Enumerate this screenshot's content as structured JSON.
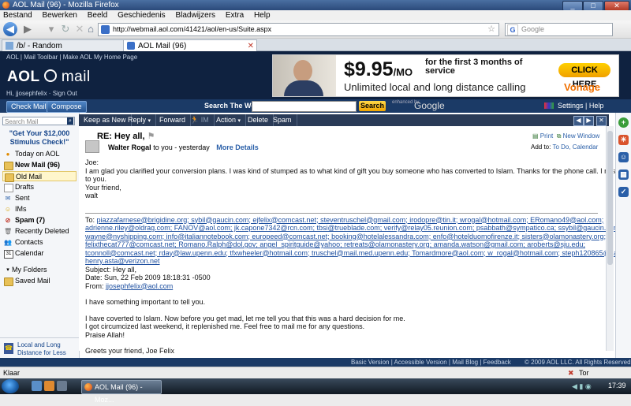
{
  "window": {
    "title": "AOL Mail (96) - Mozilla Firefox",
    "buttons": [
      "_",
      "□",
      "✕"
    ]
  },
  "menu": [
    "Bestand",
    "Bewerken",
    "Beeld",
    "Geschiedenis",
    "Bladwijzers",
    "Extra",
    "Help"
  ],
  "nav": {
    "url": "http://webmail.aol.com/41421/aol/en-us/Suite.aspx",
    "search_placeholder": "Google"
  },
  "tabs": [
    {
      "label": "/b/ - Random"
    },
    {
      "label": "AOL Mail (96)"
    }
  ],
  "aol": {
    "toplinks": "AOL  |  Mail Toolbar  |  Make AOL My Home Page",
    "logo_aol": "AOL",
    "logo_mail": "mail",
    "hi": "Hi, jjosephfelix  ·  Sign Out",
    "check_mail": "Check Mail",
    "compose": "Compose",
    "search_web_label": "Search The Web",
    "search_button": "Search",
    "enhanced_by": "enhanced by",
    "google": "Google",
    "settings": "Settings  |  Help"
  },
  "ad": {
    "price": "$9.95",
    "per": "/MO",
    "first3": "for the first 3 months of service",
    "unlimited": "Unlimited local and long distance calling",
    "cta": "CLICK HERE",
    "brand": "Vonage"
  },
  "toolbar": {
    "keep_as_new": "Keep as New",
    "reply": "Reply",
    "forward": "Forward",
    "im": "IM",
    "action": "Action",
    "delete": "Delete",
    "spam": "Spam"
  },
  "sidebar": {
    "search_placeholder": "Search Mail",
    "promo": "\"Get Your $12,000 Stimulus Check!\"",
    "items": [
      {
        "label": "Today on AOL"
      },
      {
        "label": "New Mail (96)"
      },
      {
        "label": "Old Mail"
      },
      {
        "label": "Drafts"
      },
      {
        "label": "Sent"
      },
      {
        "label": "IMs"
      },
      {
        "label": "Spam (7)"
      },
      {
        "label": "Recently Deleted"
      },
      {
        "label": "Contacts"
      },
      {
        "label": "Calendar"
      }
    ],
    "my_folders": "My Folders",
    "saved_mail": "Saved Mail",
    "local_ad": "Local and Long Distance for Less"
  },
  "message": {
    "subject": "RE: Hey all,",
    "from_name": "Walter Rogal",
    "from_meta": "to you - yesterday",
    "more_details": "More Details",
    "print": "Print",
    "new_window": "New Window",
    "add_to_label": "Add to:",
    "add_to_links": "To Do, Calendar",
    "body_top": [
      "Joe:",
      "I am glad you clarified your conversion plans.  I was kind of stumped as to what kind of gift you buy someone who has converted to Islam.  Thanks for the phone call.  I miss talking",
      "to you.",
      "Your friend,",
      "walt"
    ],
    "to_label": "To:",
    "to_lines": [
      "piazzafarnese@brigidine.org; sybil@gaucin.com; ejfelix@comcast.net; steventruschel@gmail.com; irodopre@tin.it; wrogal@hotmail.com; ERomano49@aol.com;",
      "adrienne.riley@oldrag.com; FANOV@aol.com; jk.capone7342@rcn.com; tbsi@trueblade.com; verify@relay05.reunion.com; psabbath@sympatico.ca; ssybil@gaucin.comy;",
      "wayne@nyshipping.com; info@italiannotebook.com; europeed@comcast.net; booking@hotelalessandra.com; enfo@hotelduomofirenze.it; sisters@olamonastery.org;",
      "felixthecat777@comcast.net; Romano.Ralph@dol.gov; angel_spiritguide@yahoo; retreats@olamonastery.org; amanda.watson@gmail.com; aroberts@sju.edu;",
      "tconnoll@comcast.net; rday@law.upenn.edu; tfxwheeler@hotmail.com; truschel@mail.med.upenn.edu; Tomardmore@aol.com; w_rogal@hotmail.com; steph120865@yahoo.com;",
      "henry.asta@verizon.net"
    ],
    "subject_line": "Subject: Hey all,",
    "date_line": "Date: Sun, 22 Feb 2009 18:18:31 -0500",
    "from_label": "From:",
    "from_email": "jjosephfelix@aol.com",
    "body_bottom": [
      "I have something important to tell you.",
      "",
      "I have coverted to Islam.  Now before you get mad, let me tell you that this was a hard decision for me.",
      "I got circumcized last weekend, it replenished me. Feel free to mail me for any questions.",
      "Praise Allah!",
      "",
      "Greets your friend, Joe Felix"
    ]
  },
  "footer": {
    "links": "Basic Version  |  Accessible Version  |  Mail Blog  |  Feedback",
    "copyright": "© 2009 AOL LLC. All Rights Reserved"
  },
  "status": {
    "left": "Klaar",
    "right": "Tor uitgeschakeld"
  },
  "taskbar": {
    "task": "AOL Mail (96) - Moz...",
    "time": "17:39"
  }
}
